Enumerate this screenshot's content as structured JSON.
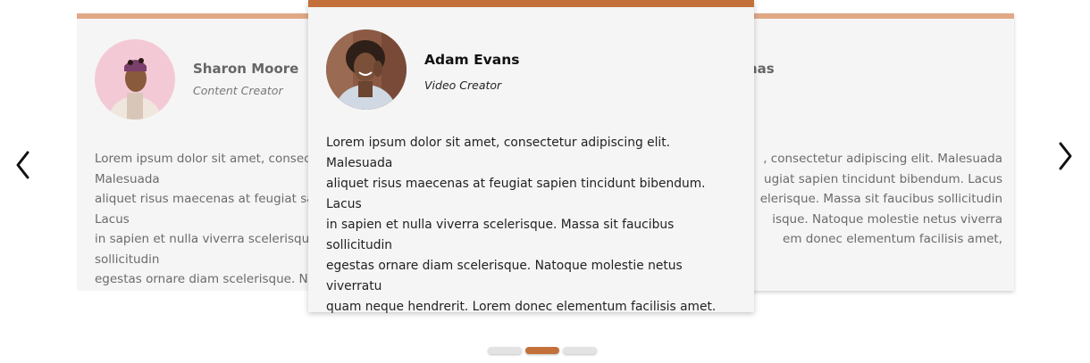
{
  "slides": [
    {
      "name": "Sharon Moore",
      "role": "Content Creator",
      "text": "Lorem ipsum dolor sit amet, consectetur adipiscing elit. Malesuada\naliquet risus maecenas at feugiat sapien tincidunt bibendum. Lacus\nin sapien et nulla viverra scelerisque. Massa sit faucibus sollicitudin\negestas ornare diam scelerisque. Natoque molestie netus viverra\nquam neque hendrerit. Lorem donec elementum facilisis amet,"
    },
    {
      "name": "Adam Evans",
      "role": "Video Creator",
      "text": "Lorem ipsum dolor sit amet, consectetur adipiscing elit. Malesuada\naliquet risus maecenas at feugiat sapien tincidunt bibendum. Lacus\nin sapien et nulla viverra scelerisque. Massa sit faucibus sollicitudin\negestas ornare diam scelerisque. Natoque molestie netus viverratu\nquam neque hendrerit. Lorem donec elementum facilisis amet."
    },
    {
      "name_visible": "mas",
      "text": ", consectetur adipiscing elit. Malesuada\nugiat sapien tincidunt bibendum. Lacus\nelerisque. Massa sit faucibus sollicitudin\nisque. Natoque molestie netus viverra\nem donec elementum facilisis amet,"
    }
  ],
  "nav": {
    "prev_icon": "chevron-left-icon",
    "next_icon": "chevron-right-icon"
  },
  "pagination": {
    "count": 3,
    "active_index": 1
  },
  "colors": {
    "accent": "#c4703a",
    "accent_light": "#e0a886",
    "card_bg": "#f5f5f5"
  }
}
